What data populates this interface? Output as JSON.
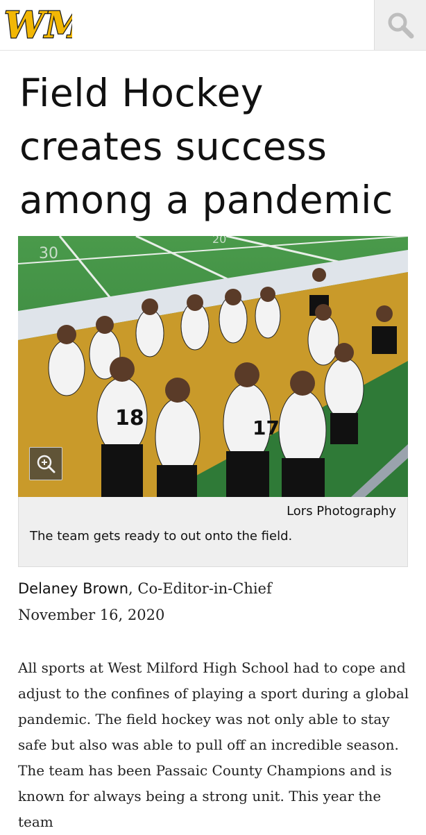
{
  "header": {
    "logo_text": "WM",
    "logo_icon": "wm-logo-icon",
    "search_icon": "search-icon"
  },
  "article": {
    "headline": "Field Hockey creates success among a pandemic",
    "photo": {
      "credit": "Lors Photography",
      "caption": "The team gets ready to out onto the field.",
      "zoom_icon": "zoom-in-icon",
      "jersey_numbers": [
        "18",
        "17",
        "20",
        "30"
      ]
    },
    "author": "Delaney Brown",
    "author_role": ", Co-Editor-in-Chief",
    "date": "November 16, 2020",
    "body": "All sports at West Milford High School had to cope and adjust to the confines of playing a sport during a global pandemic. The field hockey was not only able to stay safe but also was able to pull off an incredible season. The team has been Passaic County Champions and is known for always being a strong unit. This year the team"
  },
  "colors": {
    "logo_gold": "#f2b705",
    "logo_black": "#1a1a1a",
    "caption_bg": "#efefef",
    "field_green": "#3e8a43",
    "field_gold": "#c99a2a"
  }
}
